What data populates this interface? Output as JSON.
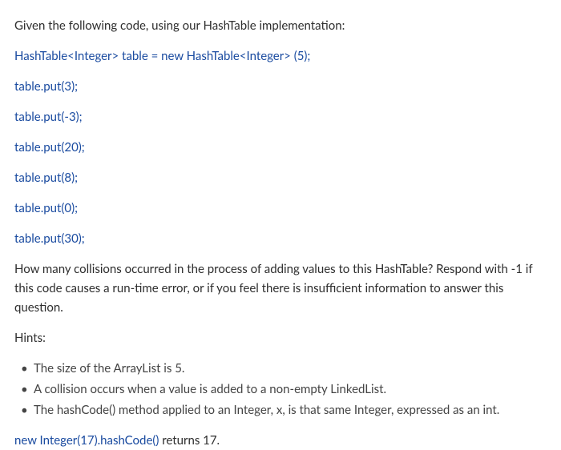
{
  "intro": "Given the following code, using our HashTable implementation:",
  "code_lines": [
    "HashTable<Integer> table = new HashTable<Integer> (5);",
    "table.put(3);",
    "table.put(-3);",
    "table.put(20);",
    "table.put(8);",
    "table.put(0);",
    "table.put(30);"
  ],
  "question": "How many collisions occurred in the process of adding values to this HashTable?  Respond with -1 if this code causes a run-time error, or if you feel there is insufficient information to answer this question.",
  "hints_label": "Hints:",
  "hints": [
    "The size of the ArrayList is 5.",
    "A collision occurs when a value is added to a non-empty LinkedList.",
    "The hashCode() method applied to an Integer, x, is that same Integer, expressed as an int."
  ],
  "example_code": "new Integer(17).hashCode()",
  "example_result": "  returns 17."
}
